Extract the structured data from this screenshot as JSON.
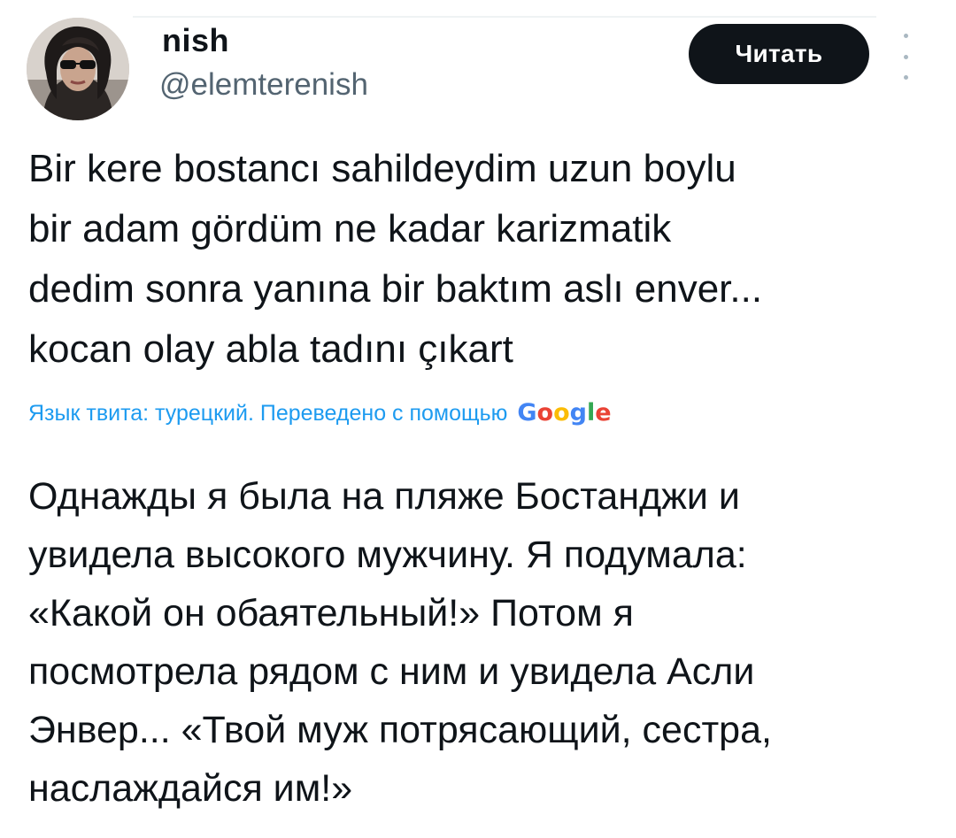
{
  "author": {
    "name": "nish",
    "handle": "@elemterenish",
    "avatar_icon": "profile-photo"
  },
  "follow_button": {
    "label": "Читать"
  },
  "more_icon": "more-vertical-icon",
  "tweet": {
    "lines": [
      "Bir kere bostancı sahildeydim uzun boylu",
      "bir adam gördüm ne kadar karizmatik",
      "dedim sonra yanına bir baktım aslı enver...",
      "kocan olay abla tadını çıkart"
    ]
  },
  "translation": {
    "note": "Язык твита: турецкий. Переведено с помощью",
    "provider_logo": "Google",
    "lines": [
      "Однажды я была на пляже Бостанджи и",
      "увидела высокого мужчину. Я подумала:",
      "«Какой он обаятельный!» Потом я",
      "посмотрела рядом с ним и увидела Асли",
      "Энвер... «Твой муж потрясающий, сестра,",
      "наслаждайся им!»"
    ]
  },
  "colors": {
    "text": "#0f1419",
    "secondary_text": "#536471",
    "link": "#1d9bf0",
    "button_bg": "#0f1419",
    "button_text": "#ffffff"
  }
}
